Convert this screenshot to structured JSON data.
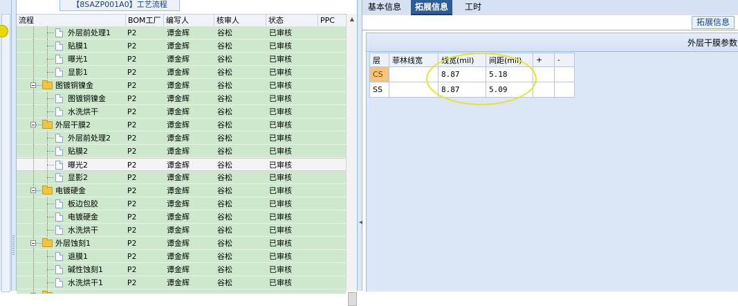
{
  "left_panel": {
    "title": "【8SAZP001A0】工艺流程",
    "columns": [
      "流程",
      "BOM工厂",
      "编写人",
      "核审人",
      "状态",
      "PPC"
    ],
    "rows": [
      {
        "name": "外层前处理1",
        "type": "doc",
        "bom": "P2",
        "writer": "谭金辉",
        "reviewer": "谷松",
        "status": "已审核"
      },
      {
        "name": "贴膜1",
        "type": "doc",
        "bom": "P2",
        "writer": "谭金辉",
        "reviewer": "谷松",
        "status": "已审核"
      },
      {
        "name": "曝光1",
        "type": "doc",
        "bom": "P2",
        "writer": "谭金辉",
        "reviewer": "谷松",
        "status": "已审核"
      },
      {
        "name": "显影1",
        "type": "doc",
        "bom": "P2",
        "writer": "谭金辉",
        "reviewer": "谷松",
        "status": "已审核"
      },
      {
        "name": "图镀铜镍金",
        "type": "folder",
        "bom": "P2",
        "writer": "谭金辉",
        "reviewer": "谷松",
        "status": "已审核"
      },
      {
        "name": "图镀铜镍金",
        "type": "doc",
        "bom": "P2",
        "writer": "谭金辉",
        "reviewer": "谷松",
        "status": "已审核"
      },
      {
        "name": "水洗烘干",
        "type": "doc",
        "bom": "P2",
        "writer": "谭金辉",
        "reviewer": "谷松",
        "status": "已审核"
      },
      {
        "name": "外层干膜2",
        "type": "folder",
        "bom": "P2",
        "writer": "谭金辉",
        "reviewer": "谷松",
        "status": "已审核"
      },
      {
        "name": "外层前处理2",
        "type": "doc",
        "bom": "P2",
        "writer": "谭金辉",
        "reviewer": "谷松",
        "status": "已审核"
      },
      {
        "name": "贴膜2",
        "type": "doc",
        "bom": "P2",
        "writer": "谭金辉",
        "reviewer": "谷松",
        "status": "已审核"
      },
      {
        "name": "曝光2",
        "type": "doc",
        "bom": "P2",
        "writer": "谭金辉",
        "reviewer": "谷松",
        "status": "已审核",
        "selected": true
      },
      {
        "name": "显影2",
        "type": "doc",
        "bom": "P2",
        "writer": "谭金辉",
        "reviewer": "谷松",
        "status": "已审核"
      },
      {
        "name": "电镀硬金",
        "type": "folder",
        "bom": "P2",
        "writer": "谭金辉",
        "reviewer": "谷松",
        "status": "已审核"
      },
      {
        "name": "板边包胶",
        "type": "doc",
        "bom": "P2",
        "writer": "谭金辉",
        "reviewer": "谷松",
        "status": "已审核"
      },
      {
        "name": "电镀硬金",
        "type": "doc",
        "bom": "P2",
        "writer": "谭金辉",
        "reviewer": "谷松",
        "status": "已审核"
      },
      {
        "name": "水洗烘干",
        "type": "doc",
        "bom": "P2",
        "writer": "谭金辉",
        "reviewer": "谷松",
        "status": "已审核"
      },
      {
        "name": "外层蚀刻1",
        "type": "folder",
        "bom": "P2",
        "writer": "谭金辉",
        "reviewer": "谷松",
        "status": "已审核"
      },
      {
        "name": "退膜1",
        "type": "doc",
        "bom": "P2",
        "writer": "谭金辉",
        "reviewer": "谷松",
        "status": "已审核"
      },
      {
        "name": "碱性蚀刻1",
        "type": "doc",
        "bom": "P2",
        "writer": "谭金辉",
        "reviewer": "谷松",
        "status": "已审核"
      },
      {
        "name": "水洗烘干1",
        "type": "doc",
        "bom": "P2",
        "writer": "谭金辉",
        "reviewer": "谷松",
        "status": "已审核"
      },
      {
        "name": "",
        "type": "folder",
        "bom": "",
        "writer": "",
        "reviewer": "",
        "status": "",
        "partial": true
      }
    ]
  },
  "right_panel": {
    "tabs": [
      {
        "label": "基本信息",
        "active": false
      },
      {
        "label": "拓展信息",
        "active": true
      },
      {
        "label": "工时",
        "active": false
      }
    ],
    "subtab_label": "拓展信息",
    "panel_title": "外层干膜参数",
    "grid": {
      "headers": [
        "层",
        "菲林线宽",
        "线宽(mil)",
        "间距(mil)",
        "+",
        "-"
      ],
      "rows": [
        {
          "layer": "CS",
          "film_width": "",
          "line_width": "8.87",
          "spacing": "5.18"
        },
        {
          "layer": "SS",
          "film_width": "",
          "line_width": "8.87",
          "spacing": "5.09"
        }
      ]
    }
  },
  "colors": {
    "tree_row_bg": "#cde8cd",
    "active_tab_bg": "#2d5d99",
    "panel_bg": "#dbe6f6",
    "highlight_ellipse": "#e7e22a",
    "layer_cell": "#f9c47a"
  }
}
